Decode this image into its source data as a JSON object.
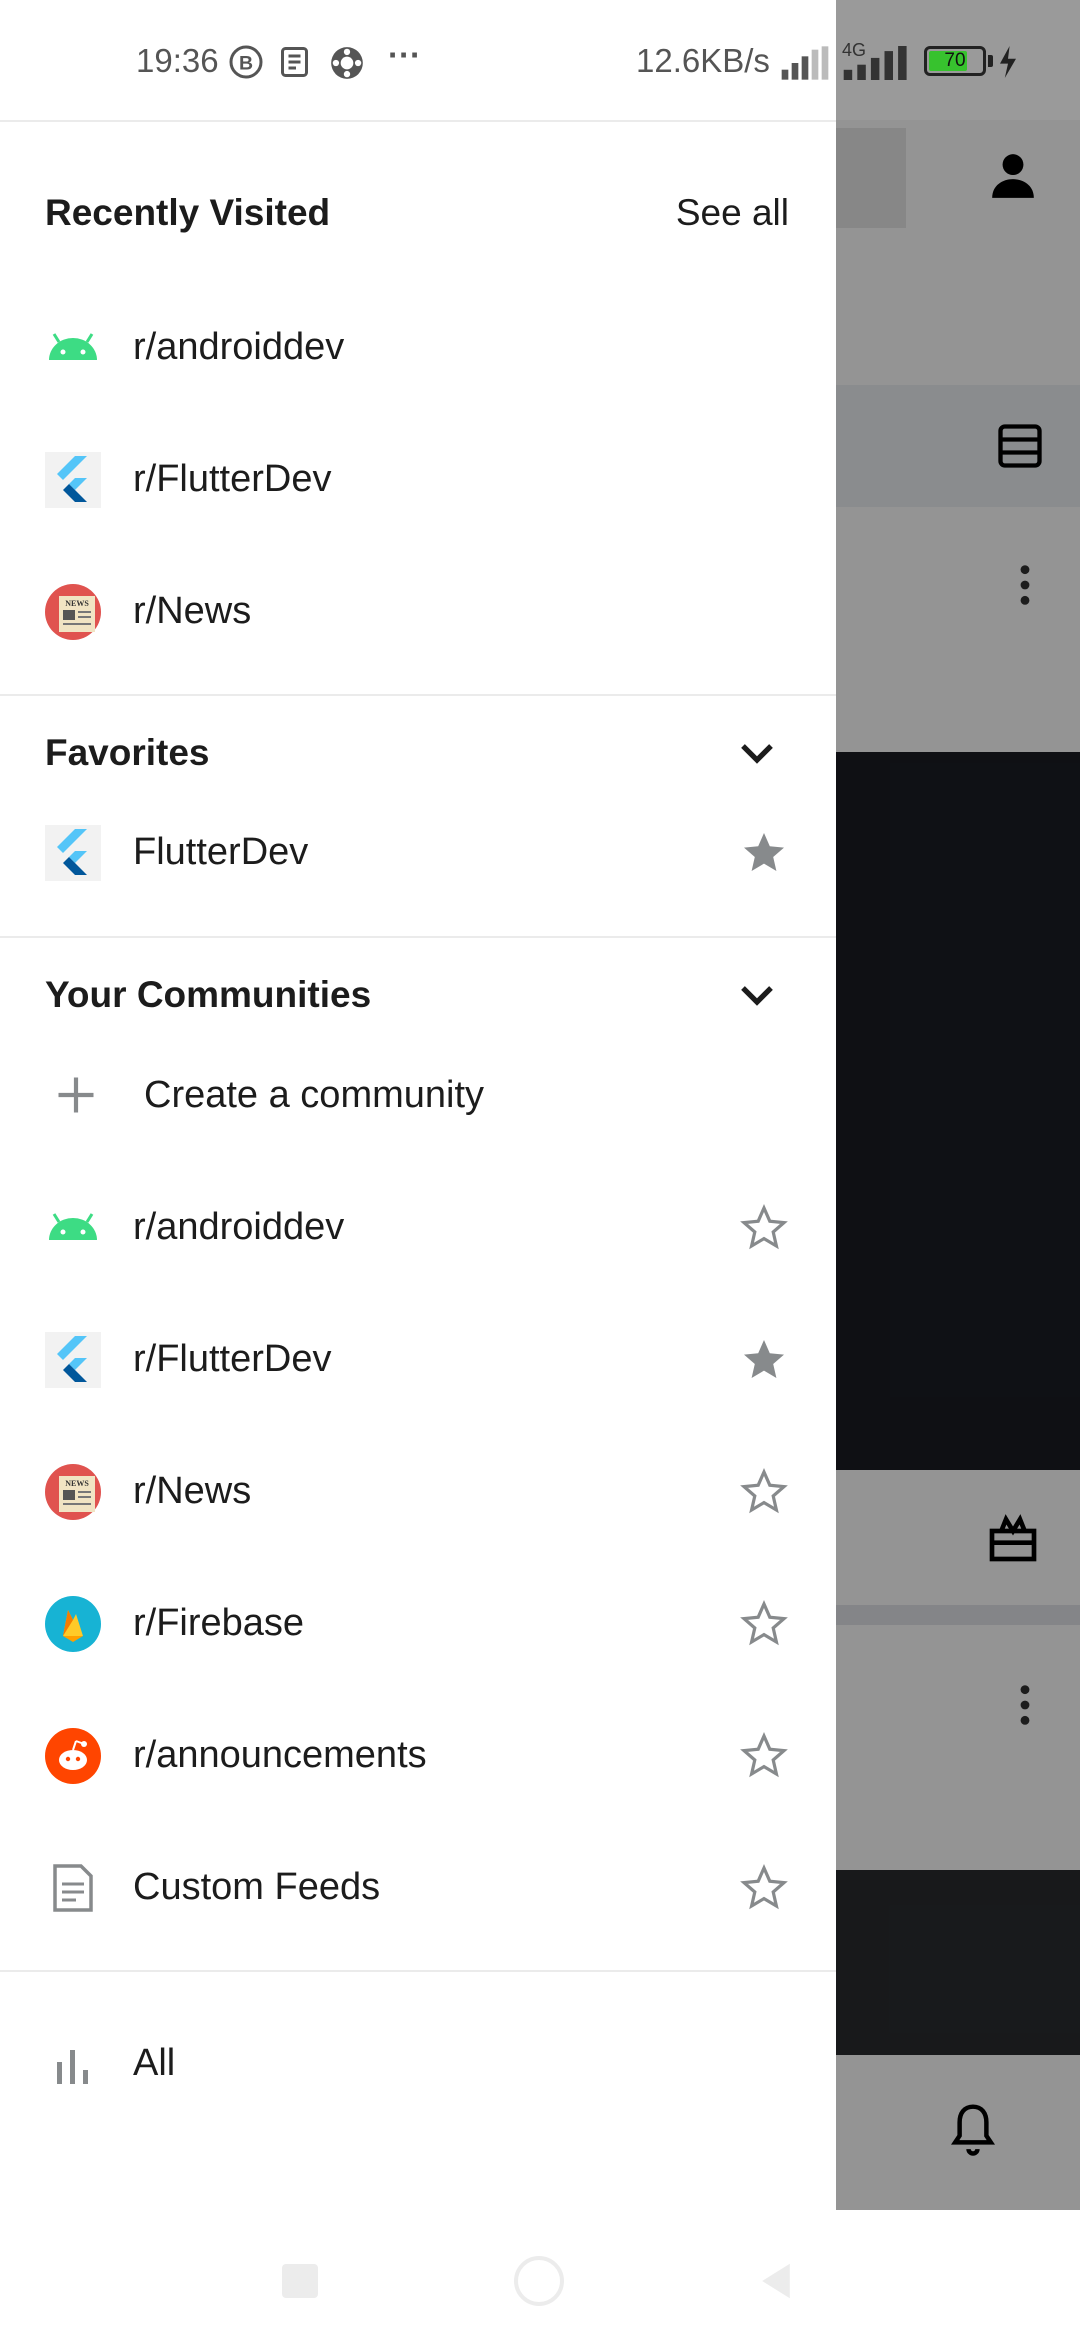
{
  "status_bar": {
    "time": "19:36",
    "net_speed": "12.6KB/s",
    "network_type": "4G",
    "battery": "70",
    "more_dots": "···"
  },
  "drawer": {
    "recent": {
      "title": "Recently Visited",
      "see_all": "See all",
      "items": [
        {
          "label": "r/androiddev",
          "icon": "android-icon"
        },
        {
          "label": "r/FlutterDev",
          "icon": "flutter-icon"
        },
        {
          "label": "r/News",
          "icon": "news-icon"
        }
      ]
    },
    "favorites": {
      "title": "Favorites",
      "items": [
        {
          "label": "FlutterDev",
          "icon": "flutter-icon",
          "starred": true
        }
      ]
    },
    "communities": {
      "title": "Your Communities",
      "create_label": "Create a community",
      "items": [
        {
          "label": "r/androiddev",
          "icon": "android-icon",
          "starred": false
        },
        {
          "label": "r/FlutterDev",
          "icon": "flutter-icon",
          "starred": true
        },
        {
          "label": "r/News",
          "icon": "news-icon",
          "starred": false
        },
        {
          "label": "r/Firebase",
          "icon": "firebase-icon",
          "starred": false
        },
        {
          "label": "r/announcements",
          "icon": "reddit-icon",
          "starred": false
        },
        {
          "label": "Custom Feeds",
          "icon": "feed-icon",
          "starred": false
        }
      ]
    },
    "all": {
      "label": "All",
      "icon": "bar-chart-icon"
    }
  },
  "colors": {
    "android_green": "#3ddc84",
    "flutter_blue": "#54c5f8",
    "flutter_dark": "#01579b",
    "reddit_orange": "#ff4500",
    "firebase_teal": "#039be5",
    "star_gray": "#878a8c"
  }
}
